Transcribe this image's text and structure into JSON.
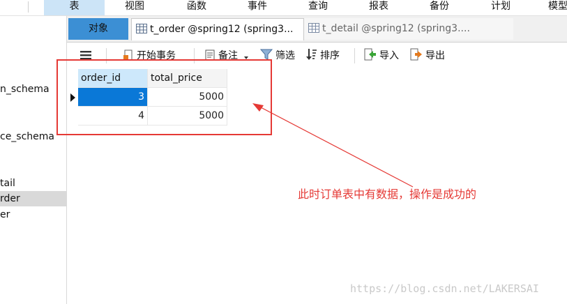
{
  "menu": {
    "items": [
      "表",
      "视图",
      "函数",
      "事件",
      "查询",
      "报表",
      "备份",
      "计划",
      "模型"
    ],
    "active_index": 0
  },
  "sidebar": {
    "items": [
      "n_schema",
      "ce_schema",
      "tail",
      "rder",
      "er"
    ],
    "selected_index": 3
  },
  "tabs": {
    "objects": "对象",
    "t_order": "t_order @spring12 (spring3...",
    "t_detail": "t_detail @spring12 (spring3...."
  },
  "toolbar": {
    "begin_transaction": "开始事务",
    "memo": "备注",
    "filter": "筛选",
    "sort": "排序",
    "import": "导入",
    "export": "导出"
  },
  "table": {
    "columns": [
      "order_id",
      "total_price"
    ],
    "rows": [
      [
        "3",
        "5000"
      ],
      [
        "4",
        "5000"
      ]
    ],
    "selected_row": 0
  },
  "annotation": {
    "text": "此时订单表中有数据，操作是成功的",
    "color": "#e53935"
  },
  "watermark": "https://blog.csdn.net/LAKERSAI"
}
